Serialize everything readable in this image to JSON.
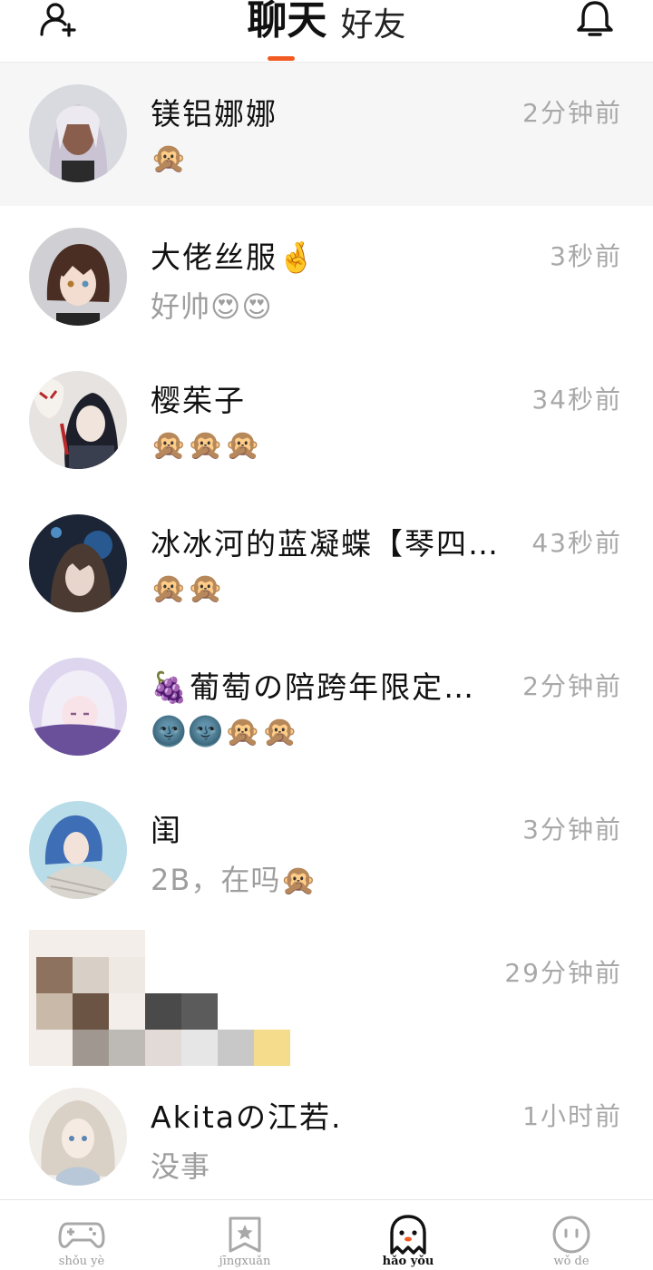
{
  "header": {
    "tab_chat": "聊天",
    "tab_friends": "好友",
    "add_friend_icon": "add-user-icon",
    "bell_icon": "bell-icon",
    "accent_color": "#f25a23"
  },
  "conversations": [
    {
      "name": "镁铝娜娜",
      "preview": "🙊",
      "time": "2分钟前",
      "highlighted": true
    },
    {
      "name": "大佬丝服🤞",
      "preview": "好帅😍😍",
      "time": "3秒前"
    },
    {
      "name": "樱茱子",
      "preview": "🙊🙊🙊",
      "time": "34秒前"
    },
    {
      "name": "冰冰河的蓝凝蝶【琴四…",
      "preview": "🙊🙊",
      "time": "43秒前"
    },
    {
      "name": "🍇葡萄の陪跨年限定…",
      "preview": "🌚🌚🙊🙊",
      "time": "2分钟前"
    },
    {
      "name": "闺",
      "preview": "2B，在吗🙊",
      "time": "3分钟前"
    },
    {
      "name": "",
      "preview": "",
      "time": "29分钟前"
    },
    {
      "name": "Akitaの江若.",
      "preview": "没事",
      "time": "1小时前"
    }
  ],
  "bottom_nav": [
    {
      "label": "shǒu yè",
      "icon": "gamepad-icon",
      "active": false
    },
    {
      "label": "jīngxuǎn",
      "icon": "star-bookmark-icon",
      "active": false
    },
    {
      "label": "hǎo yǒu",
      "icon": "ghost-icon",
      "active": true
    },
    {
      "label": "wǒ de",
      "icon": "face-icon",
      "active": false
    }
  ]
}
